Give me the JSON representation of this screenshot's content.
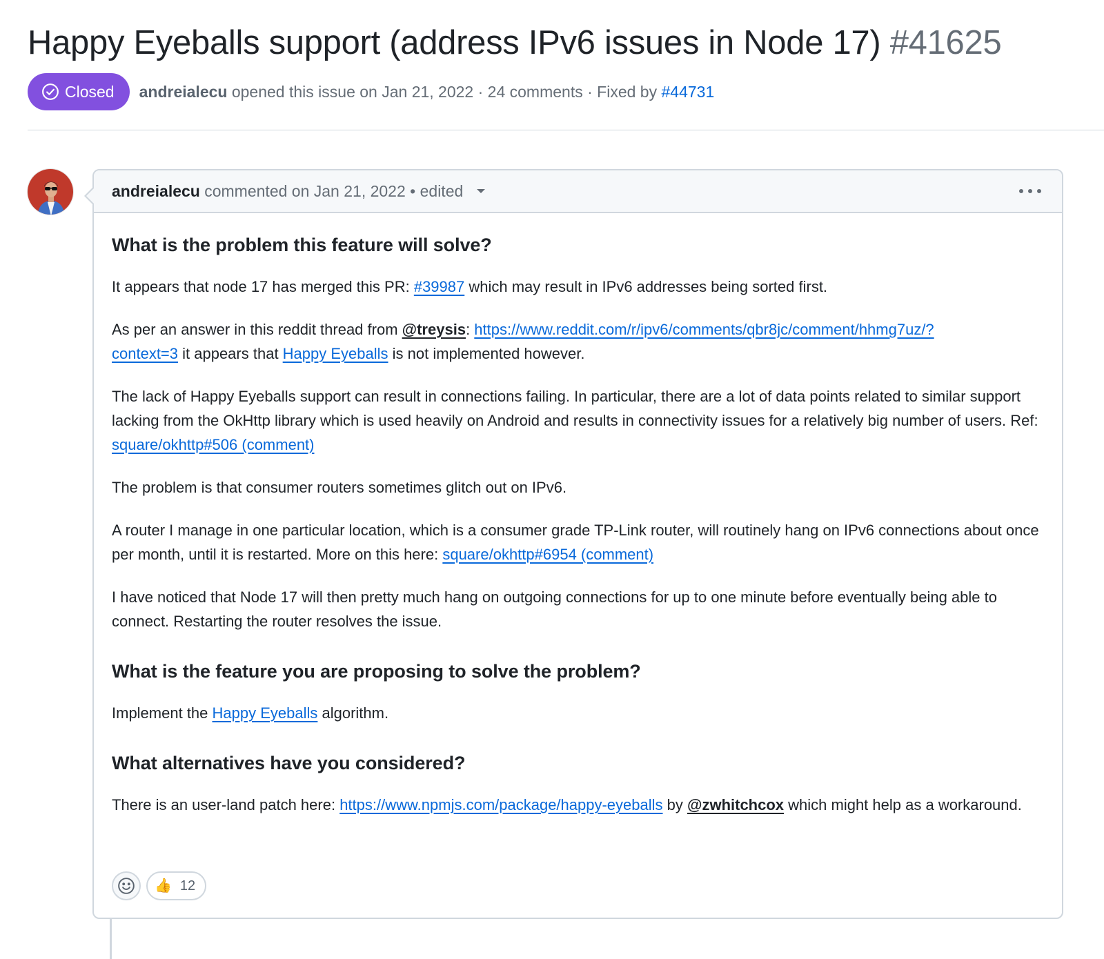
{
  "issue": {
    "title": "Happy Eyeballs support (address IPv6 issues in Node 17)",
    "number": "#41625",
    "state": "Closed",
    "state_color": "#8250df",
    "state_icon": "check-circle-icon",
    "author": "andreialecu",
    "opened_text": "opened this issue on Jan 21, 2022 · 24 comments · Fixed by",
    "fixed_by": "#44731"
  },
  "comment": {
    "author": "andreialecu",
    "commented_text": "commented on Jan 21, 2022 •",
    "edited_label": "edited",
    "menu_icon": "kebab-horizontal-icon",
    "avatar_icon": "avatar",
    "sections": {
      "h1": "What is the problem this feature will solve?",
      "p1": {
        "before": "It appears that node 17 has merged this PR: ",
        "link": "#39987",
        "after": " which may result in IPv6 addresses being sorted first."
      },
      "p2": {
        "before": "As per an answer in this reddit thread from ",
        "mention": "@treysis",
        "colon": ": ",
        "link": "https://www.reddit.com/r/ipv6/comments/qbr8jc/comment/hhmg7uz/?context=3",
        "middle": " it appears that ",
        "link2": "Happy Eyeballs",
        "after": " is not implemented however."
      },
      "p3": {
        "before": "The lack of Happy Eyeballs support can result in connections failing. In particular, there are a lot of data points related to similar support lacking from the OkHttp library which is used heavily on Android and results in connectivity issues for a relatively big number of users. Ref: ",
        "link": "square/okhttp#506 (comment)"
      },
      "p4": "The problem is that consumer routers sometimes glitch out on IPv6.",
      "p5": {
        "before": "A router I manage in one particular location, which is a consumer grade TP-Link router, will routinely hang on IPv6 connections about once per month, until it is restarted. More on this here: ",
        "link": "square/okhttp#6954 (comment)"
      },
      "p6": "I have noticed that Node 17 will then pretty much hang on outgoing connections for up to one minute before eventually being able to connect. Restarting the router resolves the issue.",
      "h2": "What is the feature you are proposing to solve the problem?",
      "p7": {
        "before": "Implement the ",
        "link": "Happy Eyeballs",
        "after": " algorithm."
      },
      "h3": "What alternatives have you considered?",
      "p8": {
        "before": "There is an user-land patch here: ",
        "link": "https://www.npmjs.com/package/happy-eyeballs",
        "middle": " by ",
        "mention": "@zwhitchcox",
        "after": " which might help as a workaround."
      }
    },
    "reactions": {
      "add_icon": "smiley-icon",
      "items": [
        {
          "emoji": "👍",
          "name": "thumbs-up",
          "count": "12"
        }
      ]
    }
  }
}
